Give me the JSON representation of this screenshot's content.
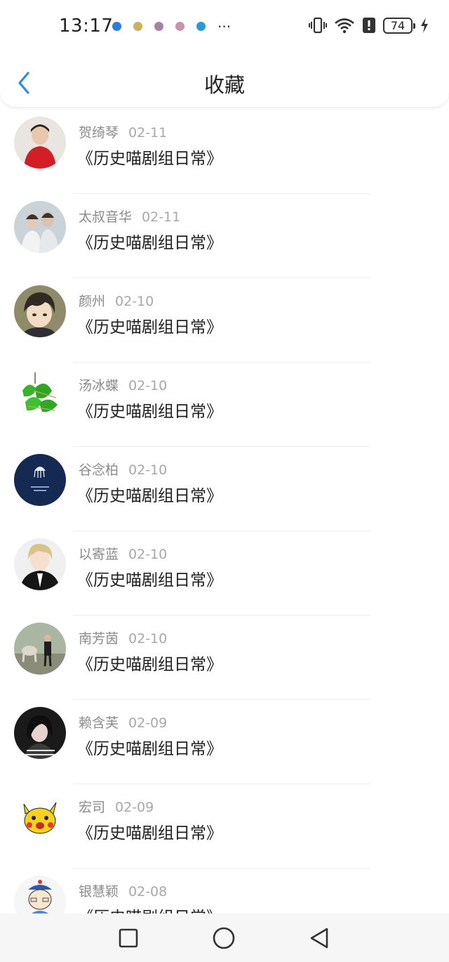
{
  "status_bar": {
    "time": "13:17",
    "notification_icons": [
      "#2a7fd6",
      "#b8a24a",
      "#a77ea8",
      "#c48aa8",
      "#2a9ad6"
    ],
    "more": "···",
    "battery": "74"
  },
  "header": {
    "title": "收藏",
    "back_icon": "chevron-left-icon",
    "accent_color": "#2d8ee6"
  },
  "items": [
    {
      "user": "贺绮琴",
      "date": "02-11",
      "title": "《历史喵剧组日常》",
      "avatar": "photo-red"
    },
    {
      "user": "太叔音华",
      "date": "02-11",
      "title": "《历史喵剧组日常》",
      "avatar": "photo-couple"
    },
    {
      "user": "颜州",
      "date": "02-10",
      "title": "《历史喵剧组日常》",
      "avatar": "anime-boy"
    },
    {
      "user": "汤冰蝶",
      "date": "02-10",
      "title": "《历史喵剧组日常》",
      "avatar": "zongzi"
    },
    {
      "user": "谷念柏",
      "date": "02-10",
      "title": "《历史喵剧组日常》",
      "avatar": "navy-jellyfish"
    },
    {
      "user": "以寄蓝",
      "date": "02-10",
      "title": "《历史喵剧组日常》",
      "avatar": "anime-blond"
    },
    {
      "user": "南芳茵",
      "date": "02-10",
      "title": "《历史喵剧组日常》",
      "avatar": "photo-outdoor"
    },
    {
      "user": "赖含芙",
      "date": "02-09",
      "title": "《历史喵剧组日常》",
      "avatar": "photo-girl"
    },
    {
      "user": "宏司",
      "date": "02-09",
      "title": "《历史喵剧组日常》",
      "avatar": "pikachu"
    },
    {
      "user": "银慧颖",
      "date": "02-08",
      "title": "《历史喵剧组日常》",
      "avatar": "qing-cartoon"
    }
  ],
  "nav": {
    "recent_icon": "square-icon",
    "home_icon": "circle-icon",
    "back_icon": "triangle-back-icon"
  }
}
